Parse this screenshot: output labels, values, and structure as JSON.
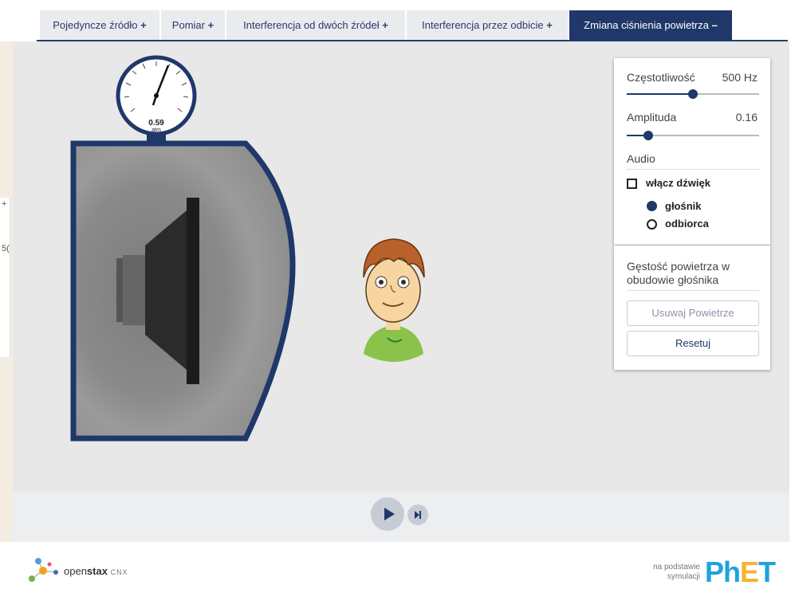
{
  "tabs": [
    {
      "label": "Pojedyncze źródło",
      "sign": "+"
    },
    {
      "label": "Pomiar",
      "sign": "+"
    },
    {
      "label": "Interferencja od dwóch źródeł",
      "sign": "+"
    },
    {
      "label": "Interferencja przez odbicie",
      "sign": "+"
    },
    {
      "label": "Zmiana ciśnienia powietrza",
      "sign": "–"
    }
  ],
  "gauge": {
    "value": "0.59",
    "unit": "atm"
  },
  "controls": {
    "frequency": {
      "label": "Częstotliwość",
      "value": "500 Hz",
      "fraction": 0.5
    },
    "amplitude": {
      "label": "Amplituda",
      "value": "0.16",
      "fraction": 0.16
    },
    "audio": {
      "label": "Audio",
      "enable_label": "włącz dźwięk",
      "enabled": false,
      "options": [
        {
          "label": "głośnik",
          "selected": true
        },
        {
          "label": "odbiorca",
          "selected": false
        }
      ]
    }
  },
  "air_panel": {
    "title": "Gęstość powietrza w obudowie głośnika",
    "remove_button": "Usuwaj Powietrze",
    "reset_button": "Resetuj"
  },
  "ghost_panel": {
    "plus": "+",
    "text": "5("
  },
  "footer": {
    "openstax_light": "open",
    "openstax_bold": "stax",
    "cnx": "CNX",
    "phet_note_line1": "na podstawie",
    "phet_note_line2": "symulacji",
    "phet_logo_ph": "Ph",
    "phet_logo_e": "E",
    "phet_logo_t": "T"
  },
  "colors": {
    "accent": "#1f3869",
    "phet_blue": "#1fa3dc",
    "phet_yellow": "#f9b233",
    "kid_shirt": "#8bc34a"
  }
}
